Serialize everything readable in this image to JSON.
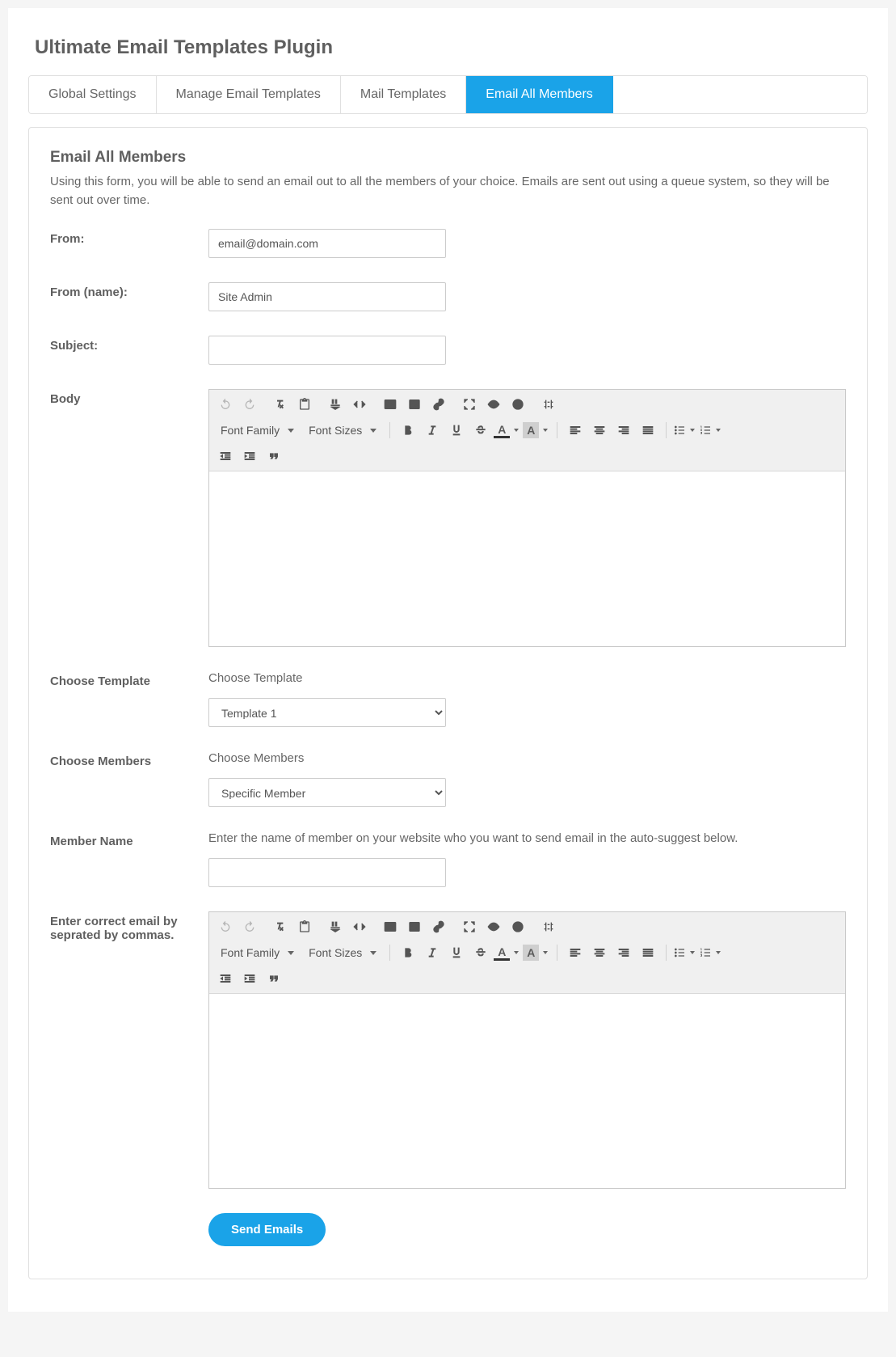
{
  "page_title": "Ultimate Email Templates Plugin",
  "tabs": [
    {
      "label": "Global Settings",
      "active": false
    },
    {
      "label": "Manage Email Templates",
      "active": false
    },
    {
      "label": "Mail Templates",
      "active": false
    },
    {
      "label": "Email All Members",
      "active": true
    }
  ],
  "section": {
    "title": "Email All Members",
    "desc": "Using this form, you will be able to send an email out to all the members of your choice. Emails are sent out using a queue system, so they will be sent out over time."
  },
  "form": {
    "from_label": "From:",
    "from_value": "email@domain.com",
    "from_name_label": "From (name):",
    "from_name_value": "Site Admin",
    "subject_label": "Subject:",
    "subject_value": "",
    "body_label": "Body",
    "template_label": "Choose Template",
    "template_helper": "Choose Template",
    "template_value": "Template 1",
    "members_label": "Choose Members",
    "members_helper": "Choose Members",
    "members_value": "Specific Member",
    "member_name_label": "Member Name",
    "member_name_helper": "Enter the name of member on your website who you want to send email in the auto-suggest below.",
    "member_name_value": "",
    "emails_label": "Enter correct email by seprated by commas.",
    "submit_label": "Send Emails"
  },
  "editor": {
    "font_family_label": "Font Family",
    "font_sizes_label": "Font Sizes"
  }
}
